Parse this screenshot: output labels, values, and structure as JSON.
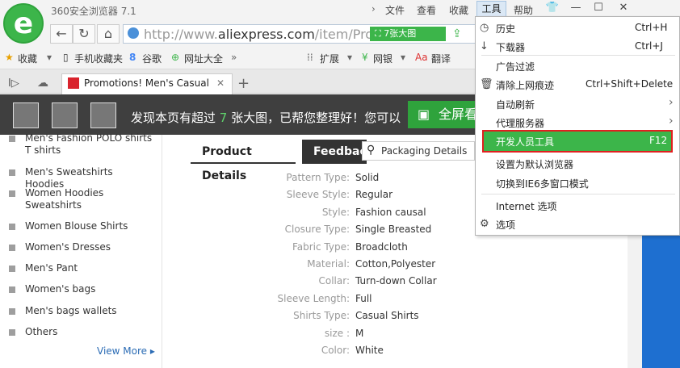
{
  "app": {
    "title": "360安全浏览器 7.1",
    "logo_letter": "e"
  },
  "menubar": {
    "file": "文件",
    "view": "查看",
    "favorites": "收藏",
    "tools": "工具",
    "help": "帮助"
  },
  "window_controls": {
    "shirt": "👕",
    "min": "—",
    "max": "☐",
    "close": "✕"
  },
  "address": {
    "url_prefix": "http://www.",
    "url_domain": "aliexpress.com",
    "url_suffix": "/item/Promc",
    "big_image_badge": "7张大图"
  },
  "bookmarks": {
    "favorites": "收藏",
    "mobile": "手机收藏夹",
    "google": "谷歌",
    "nav": "网址大全",
    "more": "»",
    "ext": "扩展",
    "bank": "网银",
    "translate": "翻译"
  },
  "tab": {
    "title": "Promotions! Men's Casual",
    "close": "✕",
    "new": "+"
  },
  "banner": {
    "text_before": "发现本页有超过 ",
    "count": "7",
    "text_after": " 张大图，已帮您整理好！您可以",
    "fullscreen": "全屏看"
  },
  "sidebar": {
    "items": [
      "Men's Fashion POLO shirts T shirts",
      "Men's Sweatshirts Hoodies",
      "Women Hoodies Sweatshirts",
      "Women Blouse Shirts",
      "Women's Dresses",
      "Men's Pant",
      "Women's bags",
      "Men's bags wallets",
      "Others"
    ],
    "view_more": "View More ▸"
  },
  "product_tabs": {
    "details": "Product Details",
    "feedback": "Feedbac",
    "search": "Packaging Details"
  },
  "specs": [
    {
      "k": "Pattern Type:",
      "v": "Solid"
    },
    {
      "k": "Sleeve Style:",
      "v": "Regular"
    },
    {
      "k": "Style:",
      "v": "Fashion causal"
    },
    {
      "k": "Closure Type:",
      "v": "Single Breasted"
    },
    {
      "k": "Fabric Type:",
      "v": "Broadcloth"
    },
    {
      "k": "Material:",
      "v": "Cotton,Polyester"
    },
    {
      "k": "Collar:",
      "v": "Turn-down Collar"
    },
    {
      "k": "Sleeve Length:",
      "v": "Full"
    },
    {
      "k": "Shirts Type:",
      "v": "Casual Shirts"
    },
    {
      "k": "size :",
      "v": "M"
    },
    {
      "k": "Color:",
      "v": "White"
    }
  ],
  "tools_menu": {
    "history": "历史",
    "history_key": "Ctrl+H",
    "downloads": "下载器",
    "downloads_key": "Ctrl+J",
    "adblock": "广告过滤",
    "clear": "清除上网痕迹",
    "clear_key": "Ctrl+Shift+Delete",
    "autorefresh": "自动刷新",
    "proxy": "代理服务器",
    "devtools": "开发人员工具",
    "devtools_key": "F12",
    "default": "设置为默认浏览器",
    "ie6": "切换到IE6多窗口模式",
    "internet": "Internet 选项",
    "options": "选项"
  },
  "colors": {
    "accent": "#3cb54a",
    "highlight_border": "#e02020",
    "link": "#2b6cb5"
  }
}
